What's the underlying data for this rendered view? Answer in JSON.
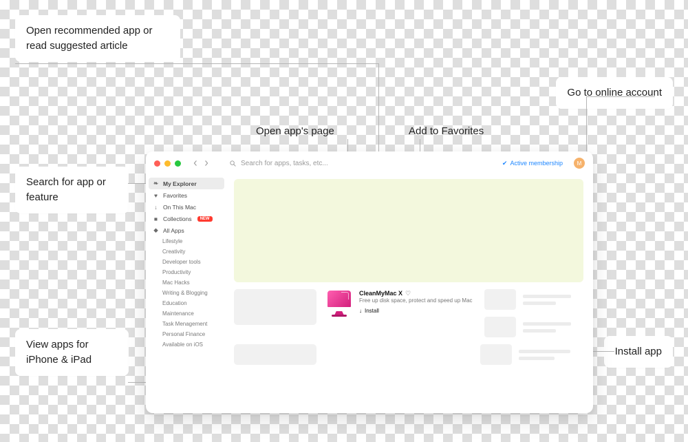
{
  "callouts": {
    "recommended": "Open recommended app or read suggested article",
    "search": "Search for app or feature",
    "ios": "View apps for iPhone & iPad",
    "account": "Go to online account",
    "install": "Install app",
    "open_page": "Open app's page",
    "favorites": "Add to Favorites"
  },
  "toolbar": {
    "search_placeholder": "Search for apps, tasks, etc...",
    "membership": "Active membership",
    "avatar_initial": "M"
  },
  "sidebar": {
    "primary": [
      {
        "label": "My Explorer",
        "icon": "leaf"
      },
      {
        "label": "Favorites",
        "icon": "heart"
      },
      {
        "label": "On This Mac",
        "icon": "download"
      },
      {
        "label": "Collections",
        "icon": "folder",
        "badge": "NEW"
      },
      {
        "label": "All Apps",
        "icon": "diamond"
      }
    ],
    "categories": [
      "Lifestyle",
      "Creativity",
      "Developer tools",
      "Productivity",
      "Mac Hacks",
      "Writing & Blogging",
      "Education",
      "Maintenance",
      "Task Menagement",
      "Personal Finance",
      "Available on iOS"
    ]
  },
  "app_card": {
    "name": "CleanMyMac X",
    "description": "Free up disk space, protect and speed up Mac",
    "install_label": "Install"
  }
}
